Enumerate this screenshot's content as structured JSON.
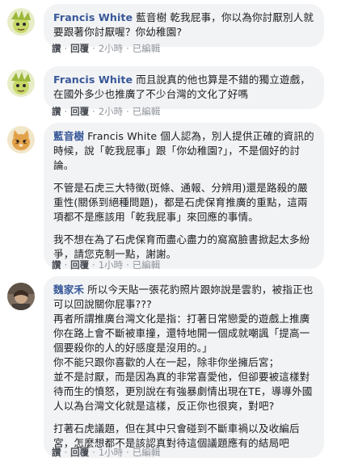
{
  "comments": [
    {
      "author": "Francis White",
      "text": "藍音樹 乾我屁事，你以為你討厭別人就要跟著你討厭喔？你幼稚園?",
      "paragraphs": [],
      "actions": {
        "like": "讚",
        "reply": "回覆",
        "time": "2小時",
        "edited": "已編輯"
      }
    },
    {
      "author": "Francis White",
      "text": "而且說真的他也算是不錯的獨立遊戲，在國外多少也推廣了不少台灣的文化了好嗎",
      "paragraphs": [],
      "actions": {
        "like": "讚",
        "reply": "回覆",
        "time": "2小時",
        "edited": "已編輯"
      }
    },
    {
      "author": "藍音樹",
      "text": "Francis White 個人認為，別人提供正確的資訊的時候，說「乾我屁事」跟「你幼稚園?」，不是個好的討論。",
      "paragraphs": [
        "不管是石虎三大特徵(斑條、通報、分辨用)還是路殺的嚴重性(關係到絕種問題)，都是石虎保育推廣的重點，這兩項都不是應該用「乾我屁事」來回應的事情。",
        "我不想在為了石虎保育而盡心盡力的窩窩臉書掀起太多紛爭，請您克制一點，謝謝。"
      ],
      "actions": {
        "like": "讚",
        "reply": "回覆",
        "time": "1小時",
        "edited": "已編輯"
      }
    },
    {
      "author": "魏家禾",
      "text": "所以今天貼一張花豹照片跟妳說是雲豹，被指正也可以回說關你屁事???\n再者所謂推廣台灣文化是指：打著日常戀愛的遊戲上推廣你在路上會不斷被車撞，還特地開一個成就嘲諷「提高一個要殺你的人的好感度是沒用的。」\n你不能只跟你喜歡的人在一起，除非你坐擁后宮；\n並不是討厭，而是因為真的非常喜愛他，但卻要被這樣對待而生的憤怒，更別說在有強暴劇情出現在TE，導導外國人以為台灣文化就是這樣，反正你也很爽，對吧?",
      "paragraphs": [
        "打著石虎議題，但在其中只會碰到不斷車禍以及收編后宮，怎麼想都不是該認真對待這個議題應有的結局吧"
      ],
      "actions": {
        "like": "讚",
        "reply": "回覆",
        "time": "1小時",
        "edited": "已編輯"
      }
    }
  ],
  "colors": {
    "author": "#385898",
    "bubble": "#f2f3f5",
    "meta": "#90949c",
    "action": "#4b4f56"
  }
}
